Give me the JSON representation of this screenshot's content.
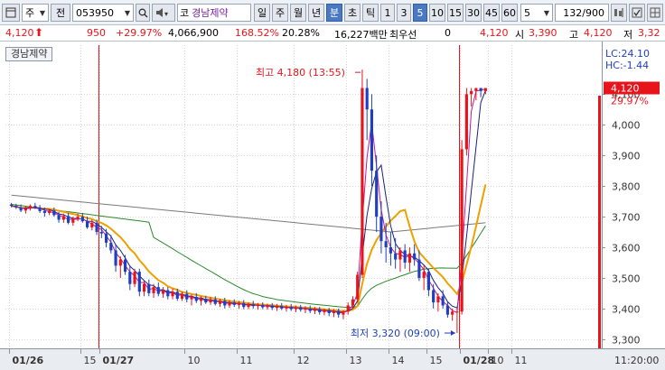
{
  "toolbar": {
    "market_label": "주",
    "prev_label": "전",
    "code": "053950",
    "market_tag": "코",
    "stock_name": "경남제약",
    "periods": [
      "일",
      "주",
      "월",
      "년",
      "분",
      "초",
      "틱"
    ],
    "active_period": "분",
    "intervals": [
      "1",
      "3",
      "5",
      "10",
      "15",
      "30",
      "45",
      "60"
    ],
    "active_interval": "5",
    "custom_interval": "5",
    "counter": "132/900"
  },
  "quote": {
    "price": "4,120",
    "change": "950",
    "change_pct": "+29.97%",
    "volume": "4,066,900",
    "volume_ratio": "168.52%",
    "turnover": "20.28%",
    "amount": "16,227백만",
    "best_label": "최우선",
    "best_value": "0",
    "ask": "4,120",
    "open_label": "시",
    "open": "3,390",
    "high_label": "고",
    "high": "4,120",
    "low_label": "저",
    "low": "3,32"
  },
  "colors": {
    "up": "#e8141b",
    "down": "#1f3fc0",
    "vline": "#e8141b",
    "ma_gray": "#7a7a7a",
    "ma_green": "#2a8a2a",
    "ma_orange": "#f0a000",
    "ma_navy": "#1a237e",
    "ma_magenta": "#c2189a"
  },
  "chart_data": {
    "type": "candlestick",
    "stock_label": "경남제약",
    "y_ticks": [
      "4,100",
      "4,000",
      "3,900",
      "3,800",
      "3,700",
      "3,600",
      "3,500",
      "3,400",
      "3,300"
    ],
    "ylim": [
      3270,
      4260
    ],
    "x_ticks": [
      "01/26",
      "15",
      "01/27",
      "10",
      "11",
      "12",
      "13",
      "14",
      "15",
      "01/28",
      "10",
      "11"
    ],
    "time_label": "11:20:00",
    "lc": "LC:24.10",
    "hc": "HC:-1.44",
    "current_price": "4,120",
    "current_pct": "29.97%",
    "max_label": "최고 4,180 (13:55)",
    "min_label": "최저 3,320 (09:00)",
    "ohlc": [
      [
        3740,
        3745,
        3730,
        3735
      ],
      [
        3735,
        3742,
        3725,
        3730
      ],
      [
        3730,
        3740,
        3715,
        3720
      ],
      [
        3720,
        3735,
        3710,
        3728
      ],
      [
        3728,
        3740,
        3720,
        3735
      ],
      [
        3735,
        3745,
        3725,
        3730
      ],
      [
        3730,
        3738,
        3712,
        3718
      ],
      [
        3718,
        3730,
        3700,
        3712
      ],
      [
        3712,
        3725,
        3705,
        3720
      ],
      [
        3720,
        3730,
        3700,
        3705
      ],
      [
        3705,
        3715,
        3680,
        3690
      ],
      [
        3690,
        3710,
        3680,
        3702
      ],
      [
        3702,
        3712,
        3675,
        3680
      ],
      [
        3680,
        3700,
        3670,
        3695
      ],
      [
        3695,
        3710,
        3685,
        3700
      ],
      [
        3700,
        3712,
        3680,
        3685
      ],
      [
        3685,
        3700,
        3660,
        3665
      ],
      [
        3665,
        3690,
        3655,
        3680
      ],
      [
        3680,
        3690,
        3640,
        3650
      ],
      [
        3650,
        3670,
        3630,
        3645
      ],
      [
        3645,
        3660,
        3600,
        3615
      ],
      [
        3615,
        3640,
        3580,
        3590
      ],
      [
        3590,
        3610,
        3520,
        3540
      ],
      [
        3540,
        3570,
        3500,
        3560
      ],
      [
        3560,
        3575,
        3510,
        3520
      ],
      [
        3520,
        3540,
        3460,
        3480
      ],
      [
        3480,
        3530,
        3470,
        3520
      ],
      [
        3520,
        3530,
        3440,
        3455
      ],
      [
        3455,
        3490,
        3440,
        3480
      ],
      [
        3480,
        3495,
        3440,
        3450
      ],
      [
        3450,
        3480,
        3435,
        3470
      ],
      [
        3470,
        3485,
        3440,
        3448
      ],
      [
        3448,
        3470,
        3435,
        3460
      ],
      [
        3460,
        3470,
        3430,
        3440
      ],
      [
        3440,
        3465,
        3430,
        3455
      ],
      [
        3455,
        3465,
        3425,
        3432
      ],
      [
        3432,
        3455,
        3425,
        3448
      ],
      [
        3448,
        3460,
        3420,
        3430
      ],
      [
        3430,
        3445,
        3410,
        3438
      ],
      [
        3438,
        3450,
        3418,
        3425
      ],
      [
        3425,
        3440,
        3410,
        3432
      ],
      [
        3432,
        3442,
        3415,
        3420
      ],
      [
        3420,
        3438,
        3412,
        3430
      ],
      [
        3430,
        3440,
        3410,
        3415
      ],
      [
        3415,
        3432,
        3405,
        3425
      ],
      [
        3425,
        3435,
        3400,
        3410
      ],
      [
        3410,
        3428,
        3402,
        3420
      ],
      [
        3420,
        3430,
        3405,
        3412
      ],
      [
        3412,
        3425,
        3400,
        3418
      ],
      [
        3418,
        3428,
        3398,
        3405
      ],
      [
        3405,
        3420,
        3398,
        3414
      ],
      [
        3414,
        3425,
        3400,
        3408
      ],
      [
        3408,
        3418,
        3396,
        3412
      ],
      [
        3412,
        3420,
        3398,
        3404
      ],
      [
        3404,
        3416,
        3396,
        3410
      ],
      [
        3410,
        3418,
        3395,
        3402
      ],
      [
        3402,
        3415,
        3392,
        3408
      ],
      [
        3408,
        3418,
        3395,
        3400
      ],
      [
        3400,
        3412,
        3390,
        3405
      ],
      [
        3405,
        3415,
        3392,
        3398
      ],
      [
        3398,
        3410,
        3388,
        3404
      ],
      [
        3404,
        3412,
        3390,
        3396
      ],
      [
        3396,
        3408,
        3385,
        3400
      ],
      [
        3400,
        3410,
        3385,
        3392
      ],
      [
        3392,
        3405,
        3382,
        3398
      ],
      [
        3398,
        3405,
        3380,
        3388
      ],
      [
        3388,
        3400,
        3378,
        3395
      ],
      [
        3395,
        3402,
        3375,
        3385
      ],
      [
        3385,
        3398,
        3372,
        3392
      ],
      [
        3392,
        3400,
        3370,
        3380
      ],
      [
        3380,
        3395,
        3365,
        3390
      ],
      [
        3390,
        3420,
        3380,
        3410
      ],
      [
        3410,
        3440,
        3400,
        3430
      ],
      [
        3430,
        3520,
        3420,
        3510
      ],
      [
        3510,
        4180,
        3500,
        4120
      ],
      [
        4120,
        4150,
        3950,
        4050
      ],
      [
        4050,
        4100,
        3800,
        3850
      ],
      [
        3850,
        3900,
        3650,
        3700
      ],
      [
        3700,
        3750,
        3580,
        3620
      ],
      [
        3620,
        3680,
        3550,
        3600
      ],
      [
        3600,
        3650,
        3540,
        3580
      ],
      [
        3580,
        3630,
        3530,
        3560
      ],
      [
        3560,
        3600,
        3520,
        3590
      ],
      [
        3590,
        3610,
        3530,
        3550
      ],
      [
        3550,
        3600,
        3520,
        3580
      ],
      [
        3580,
        3610,
        3540,
        3560
      ],
      [
        3560,
        3590,
        3490,
        3500
      ],
      [
        3500,
        3540,
        3460,
        3520
      ],
      [
        3520,
        3530,
        3440,
        3460
      ],
      [
        3460,
        3480,
        3400,
        3420
      ],
      [
        3420,
        3450,
        3390,
        3440
      ],
      [
        3440,
        3460,
        3400,
        3410
      ],
      [
        3410,
        3420,
        3370,
        3380
      ],
      [
        3380,
        3400,
        3360,
        3390
      ],
      [
        3390,
        3400,
        3320,
        3390
      ],
      [
        3390,
        3950,
        3380,
        3920
      ],
      [
        3920,
        4120,
        3900,
        4100
      ],
      [
        4100,
        4120,
        4060,
        4110
      ],
      [
        4110,
        4120,
        4080,
        4120
      ],
      [
        4120,
        4120,
        4090,
        4110
      ],
      [
        4110,
        4120,
        4100,
        4120
      ]
    ]
  }
}
